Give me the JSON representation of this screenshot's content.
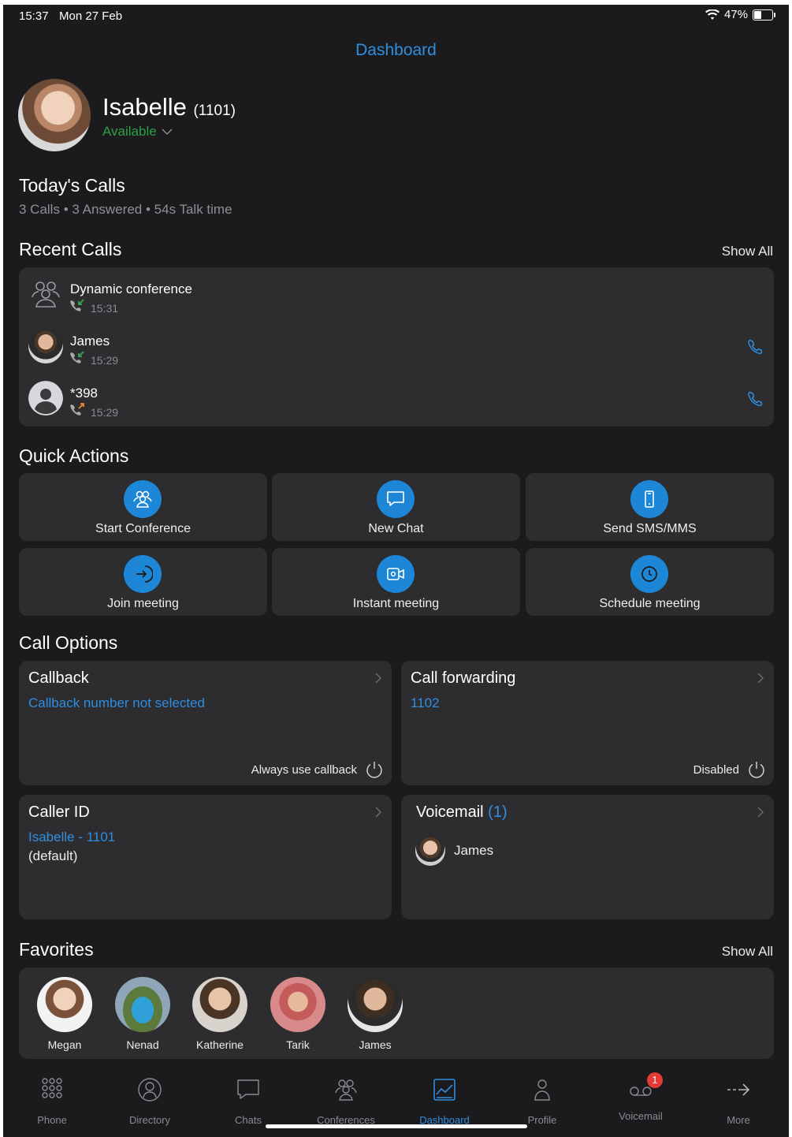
{
  "status_bar": {
    "time": "15:37",
    "date": "Mon 27 Feb",
    "battery_percent": "47%",
    "battery_level": 0.47
  },
  "header": {
    "title": "Dashboard"
  },
  "user": {
    "name": "Isabelle",
    "ext": "(1101)",
    "status": "Available"
  },
  "todays_calls": {
    "title": "Today's Calls",
    "calls": "3 Calls",
    "answered": "3 Answered",
    "talk_time": "54s Talk time",
    "separator": "•"
  },
  "recent_calls": {
    "title": "Recent Calls",
    "show_all": "Show All",
    "items": [
      {
        "name": "Dynamic conference",
        "time": "15:31",
        "direction": "incoming",
        "avatar": "conference-icon"
      },
      {
        "name": "James",
        "time": "15:29",
        "direction": "incoming",
        "avatar": "photo"
      },
      {
        "name": "*398",
        "time": "15:29",
        "direction": "outgoing",
        "avatar": "person-placeholder-icon"
      }
    ]
  },
  "quick_actions": {
    "title": "Quick Actions",
    "items": [
      {
        "label": "Start Conference",
        "icon": "conference-icon"
      },
      {
        "label": "New Chat",
        "icon": "chat-bubble-icon"
      },
      {
        "label": "Send SMS/MMS",
        "icon": "mobile-phone-icon"
      },
      {
        "label": "Join meeting",
        "icon": "enter-arrow-icon"
      },
      {
        "label": "Instant meeting",
        "icon": "video-camera-icon"
      },
      {
        "label": "Schedule meeting",
        "icon": "clock-icon"
      }
    ]
  },
  "call_options": {
    "title": "Call Options",
    "callback": {
      "title": "Callback",
      "value": "Callback number not selected",
      "toggle_label": "Always use callback"
    },
    "forwarding": {
      "title": "Call forwarding",
      "value": "1102",
      "toggle_label": "Disabled"
    },
    "caller_id": {
      "title": "Caller ID",
      "value": "Isabelle - 1101",
      "note": "(default)"
    },
    "voicemail": {
      "title": "Voicemail",
      "count": "(1)",
      "from": "James"
    }
  },
  "favorites": {
    "title": "Favorites",
    "show_all": "Show All",
    "items": [
      {
        "name": "Megan"
      },
      {
        "name": "Nenad"
      },
      {
        "name": "Katherine"
      },
      {
        "name": "Tarik"
      },
      {
        "name": "James"
      }
    ]
  },
  "tabs": [
    {
      "label": "Phone",
      "icon": "dialpad-icon"
    },
    {
      "label": "Directory",
      "icon": "directory-icon"
    },
    {
      "label": "Chats",
      "icon": "chat-icon"
    },
    {
      "label": "Conferences",
      "icon": "conference-icon"
    },
    {
      "label": "Dashboard",
      "icon": "dashboard-icon",
      "active": true
    },
    {
      "label": "Profile",
      "icon": "profile-icon"
    },
    {
      "label": "Voicemail",
      "icon": "voicemail-icon",
      "badge": "1"
    },
    {
      "label": "More",
      "icon": "more-arrow-icon"
    }
  ],
  "colors": {
    "accent": "#2f8ee0",
    "available": "#2ea043",
    "card": "#2d2d30",
    "background": "#1b1b1d",
    "badge": "#e53935"
  }
}
